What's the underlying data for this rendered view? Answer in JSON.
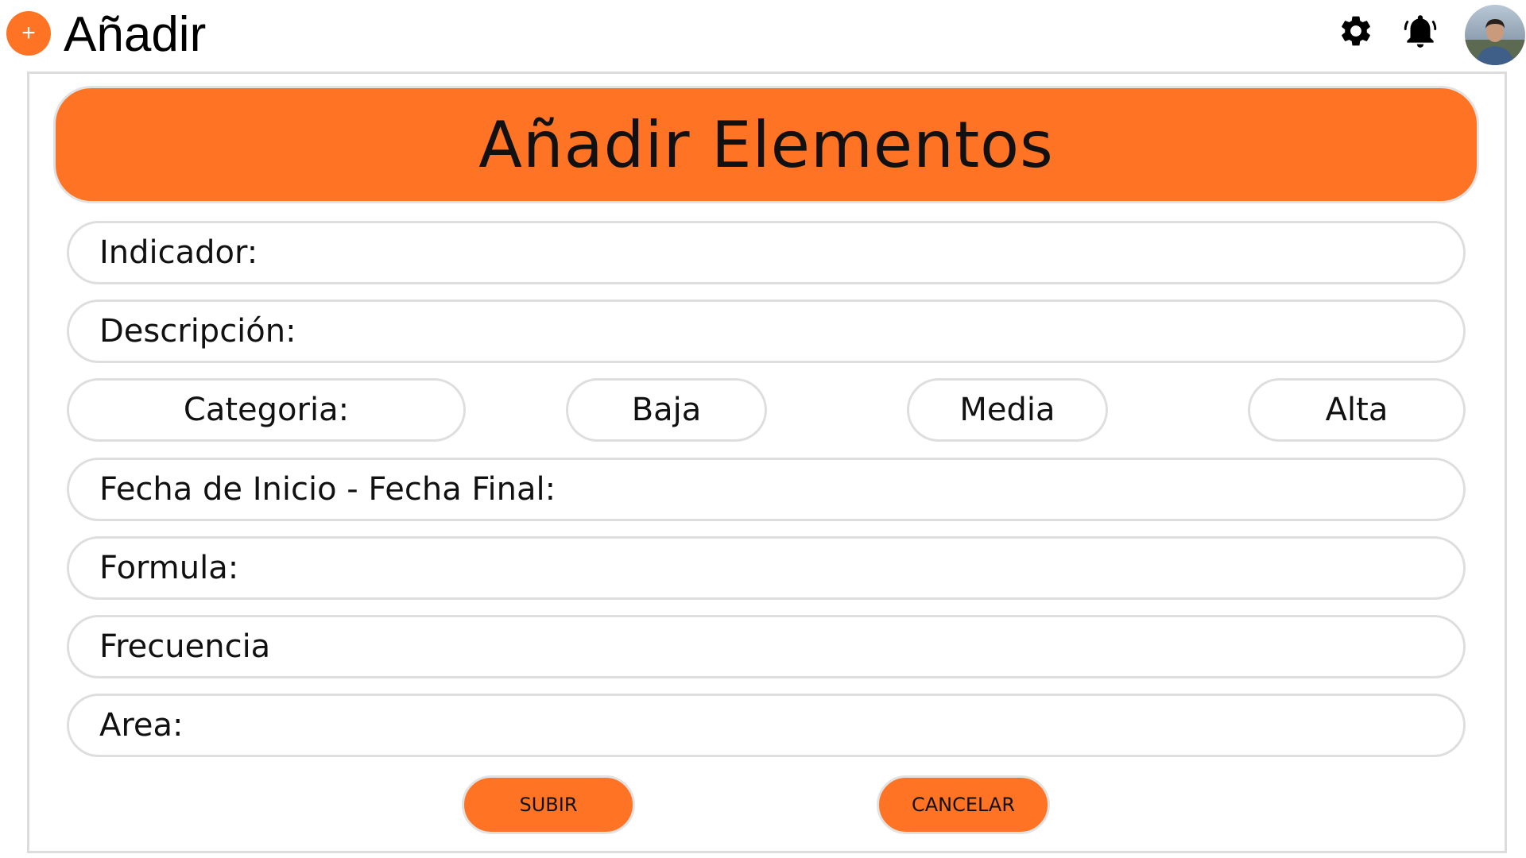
{
  "app": {
    "title": "Añadir",
    "add_symbol": "+"
  },
  "header": {
    "icons": [
      "settings-gear-icon",
      "notification-bell-icon"
    ],
    "avatar": "user-avatar"
  },
  "form": {
    "title": "Añadir Elementos",
    "fields": {
      "indicador": "Indicador:",
      "descripcion": "Descripción:",
      "fechas": "Fecha de Inicio - Fecha Final:",
      "formula": "Formula:",
      "frecuencia": "Frecuencia",
      "area": "Area:"
    },
    "categoria": {
      "label": "Categoria:",
      "options": [
        "Baja",
        "Media",
        "Alta"
      ]
    },
    "buttons": {
      "submit": "SUBIR",
      "cancel": "CANCELAR"
    }
  },
  "colors": {
    "accent": "#ff7424",
    "border": "#dedede",
    "background": "#ffffff"
  }
}
